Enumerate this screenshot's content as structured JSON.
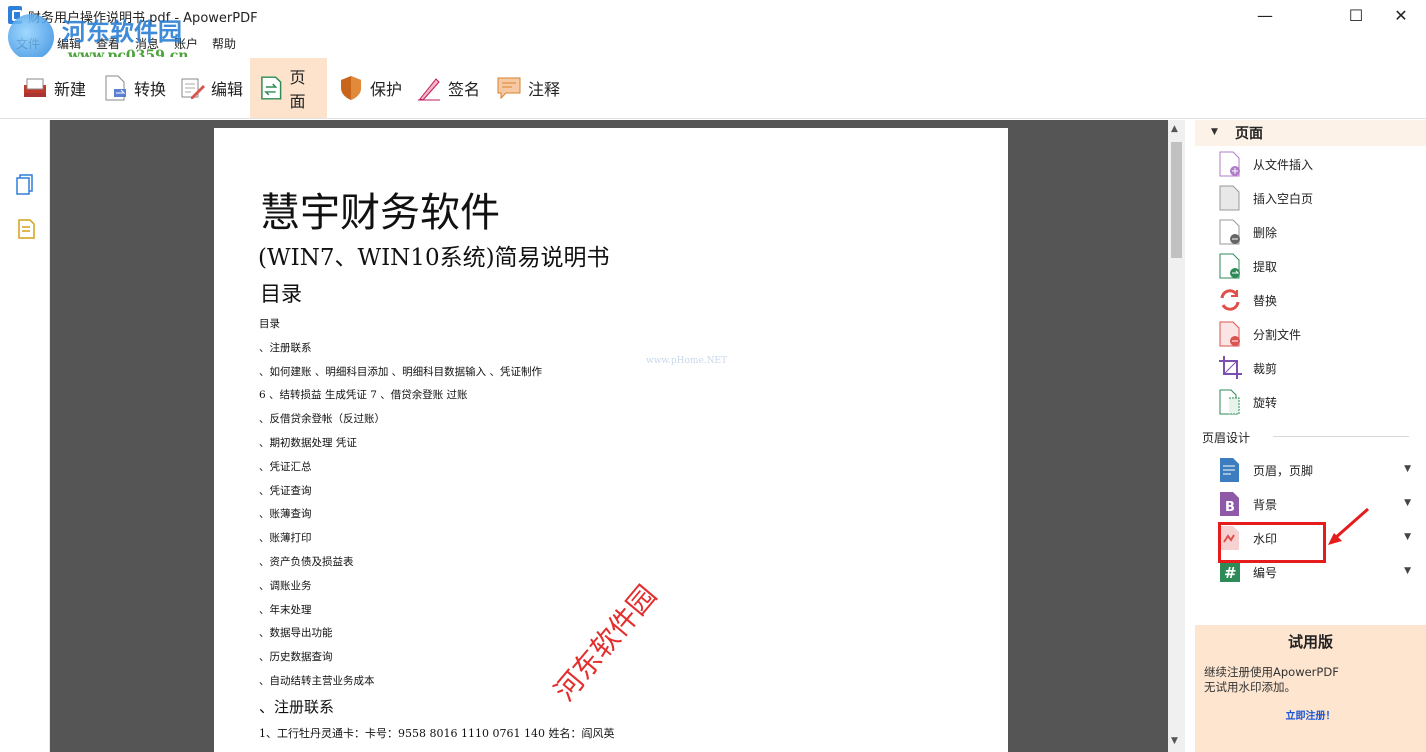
{
  "window": {
    "title": "财务用户操作说明书.pdf - ApowerPDF",
    "minimize": "—",
    "maximize": "☐",
    "close": "✕"
  },
  "menu": [
    "文件",
    "编辑",
    "查看",
    "消息",
    "账户",
    "帮助"
  ],
  "overlay_watermark": {
    "name": "河东软件园",
    "url": "www.pc0359.cn"
  },
  "toolbar": {
    "items": [
      {
        "label": "新建",
        "icon": "new-file-icon"
      },
      {
        "label": "转换",
        "icon": "convert-icon"
      },
      {
        "label": "编辑",
        "icon": "edit-icon"
      },
      {
        "label": "页面",
        "icon": "page-icon",
        "active": true
      },
      {
        "label": "保护",
        "icon": "shield-icon"
      },
      {
        "label": "签名",
        "icon": "sign-icon"
      },
      {
        "label": "注释",
        "icon": "comment-icon"
      }
    ]
  },
  "document": {
    "title": "慧宇财务软件",
    "subtitle": "(WIN7、WIN10系统)简易说明书",
    "contents_heading": "目录",
    "toc": [
      "目录",
      "、注册联系",
      "、如何建账 、明细科目添加 、明细科目数据输入 、凭证制作",
      "6 、结转损益 生成凭证 7 、借贷余登账 过账",
      "、反借贷余登帐（反过账）",
      "、期初数据处理 凭证",
      "、凭证汇总",
      "、凭证查询",
      "、账薄查询",
      "、账薄打印",
      "、资产负债及损益表",
      "、调账业务",
      "、年末处理",
      "、数据导出功能",
      "、历史数据查询",
      "、自动结转主营业务成本"
    ],
    "section_heading": "、注册联系",
    "bank_line": "1、工行牡丹灵通卡：卡号：9558 8016 1110 0761 140 姓名：阎风英",
    "red_watermark": "河东软件园",
    "faint_watermark": "www.pHome.NET"
  },
  "panel": {
    "header": "页面",
    "items": [
      {
        "label": "从文件插入",
        "icon": "insert-from-file-icon"
      },
      {
        "label": "插入空白页",
        "icon": "blank-page-icon"
      },
      {
        "label": "删除",
        "icon": "delete-page-icon"
      },
      {
        "label": "提取",
        "icon": "extract-page-icon"
      },
      {
        "label": "替换",
        "icon": "replace-icon"
      },
      {
        "label": "分割文件",
        "icon": "split-file-icon"
      },
      {
        "label": "裁剪",
        "icon": "crop-icon"
      },
      {
        "label": "旋转",
        "icon": "rotate-icon"
      }
    ],
    "design_group": "页眉设计",
    "design_items": [
      {
        "label": "页眉，页脚",
        "icon": "header-footer-icon"
      },
      {
        "label": "背景",
        "icon": "background-icon"
      },
      {
        "label": "水印",
        "icon": "watermark-icon"
      },
      {
        "label": "编号",
        "icon": "numbering-icon"
      }
    ]
  },
  "trial": {
    "title": "试用版",
    "desc": "继续注册使用ApowerPDF\n无试用水印添加。",
    "link": "立即注册！"
  },
  "colors": {
    "accent": "#fde3cc",
    "highlight": "#e51c1c",
    "link": "#1a56d8"
  }
}
